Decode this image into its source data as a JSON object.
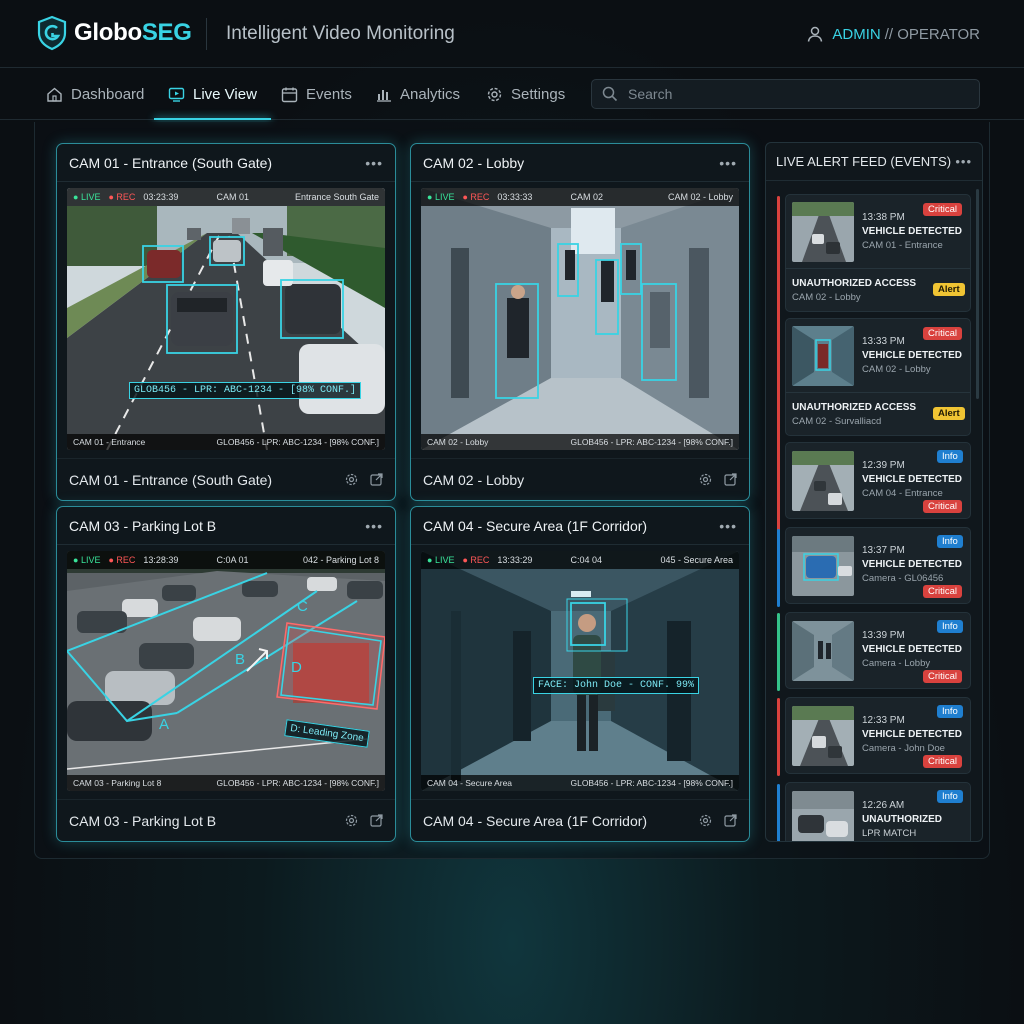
{
  "header": {
    "brand_main": "Globo",
    "brand_accent": "SEG",
    "app_title": "Intelligent Video Monitoring",
    "user_role": "ADMIN",
    "user_role_secondary": "// OPERATOR",
    "icons": {
      "logo": "shield-g-logo",
      "user": "user-icon"
    }
  },
  "nav": {
    "items": [
      {
        "label": "Dashboard",
        "icon": "home-icon"
      },
      {
        "label": "Live View",
        "icon": "monitor-play-icon",
        "active": true
      },
      {
        "label": "Events",
        "icon": "calendar-icon"
      },
      {
        "label": "Analytics",
        "icon": "bar-chart-icon"
      },
      {
        "label": "Settings",
        "icon": "gear-icon"
      }
    ],
    "search_placeholder": "Search"
  },
  "colors": {
    "accent": "#39d3e4",
    "critical": "#d9423e",
    "info": "#1f7fd0",
    "alert": "#f0c433",
    "live": "#39e49a",
    "rec": "#ff5757"
  },
  "cameras": [
    {
      "title": "CAM 01 - Entrance (South Gate)",
      "live": "LIVE",
      "rec": "REC",
      "time": "03:23:39",
      "cam_id": "CAM 01",
      "location": "Entrance South Gate",
      "bottom_left": "CAM 01 - Entrance",
      "bottom_right": "GLOB456 - LPR: ABC-1234 - [98% CONF.]",
      "detection_label": "GLOB456 - LPR: ABC-1234 - [98% CONF.]",
      "footer": "CAM 01 - Entrance (South Gate)"
    },
    {
      "title": "CAM 02 - Lobby",
      "live": "LIVE",
      "rec": "REC",
      "time": "03:33:33",
      "cam_id": "CAM 02",
      "location": "CAM 02 - Lobby",
      "bottom_left": "CAM 02 - Lobby",
      "bottom_right": "GLOB456 - LPR: ABC-1234 - [98% CONF.]",
      "footer": "CAM 02 - Lobby"
    },
    {
      "title": "CAM 03 - Parking Lot B",
      "live": "LIVE",
      "rec": "REC",
      "time": "13:28:39",
      "cam_id": "C:0A 01",
      "location": "042 - Parking Lot 8",
      "bottom_left": "CAM 03 - Parking Lot 8",
      "bottom_right": "GLOB456 - LPR: ABC-1234 - [98% CONF.]",
      "zone_labels": [
        "A",
        "B",
        "C",
        "D"
      ],
      "detection_label": "D: Leading Zone",
      "footer": "CAM 03 - Parking Lot B"
    },
    {
      "title": "CAM 04 - Secure Area (1F Corridor)",
      "live": "LIVE",
      "rec": "REC",
      "time": "13:33:29",
      "cam_id": "C:04 04",
      "location": "045 - Secure Area",
      "bottom_left": "CAM 04 - Secure Area",
      "bottom_right": "GLOB456 - LPR: ABC-1234 - [98% CONF.]",
      "detection_label": "FACE: John Doe - CONF. 99%",
      "footer": "CAM 04 - Secure Area (1F Corridor)"
    }
  ],
  "camera_icons": {
    "more": "more-dots-icon",
    "settings": "settings-icon",
    "expand": "external-link-icon"
  },
  "alert_feed": {
    "title": "LIVE ALERT FEED (EVENTS)",
    "cards": [
      {
        "time": "13:38 PM",
        "title": "VEHICLE DETECTED",
        "sub": "CAM 01 - Entrance",
        "badge": "Critical",
        "extra_title": "UNAUTHORIZED ACCESS",
        "extra_sub": "CAM 02 - Lobby",
        "extra_badge": "Alert"
      },
      {
        "time": "13:33 PM",
        "title": "VEHICLE DETECTED",
        "sub": "CAM 02 - Lobby",
        "badge": "Critical",
        "extra_title": "UNAUTHORIZED ACCESS",
        "extra_sub": "CAM 02 - Survalliacd",
        "extra_badge": "Alert"
      },
      {
        "time": "12:39 PM",
        "title": "VEHICLE DETECTED",
        "sub": "CAM 04 - Entrance",
        "badge": "Info",
        "badge2": "Critical"
      },
      {
        "time": "13:37 PM",
        "title": "VEHICLE DETECTED",
        "sub": "Camera - GL06456",
        "badge": "Info",
        "badge2": "Critical"
      },
      {
        "time": "13:39 PM",
        "title": "VEHICLE DETECTED",
        "sub": "Camera - Lobby",
        "badge": "Info",
        "badge2": "Critical"
      },
      {
        "time": "12:33 PM",
        "title": "VEHICLE DETECTED",
        "sub": "Camera - John Doe",
        "badge": "Info",
        "badge2": "Critical"
      },
      {
        "time": "12:26 AM",
        "title": "UNAUTHORIZED",
        "title2": "LPR MATCH",
        "badge": "Info"
      }
    ]
  }
}
